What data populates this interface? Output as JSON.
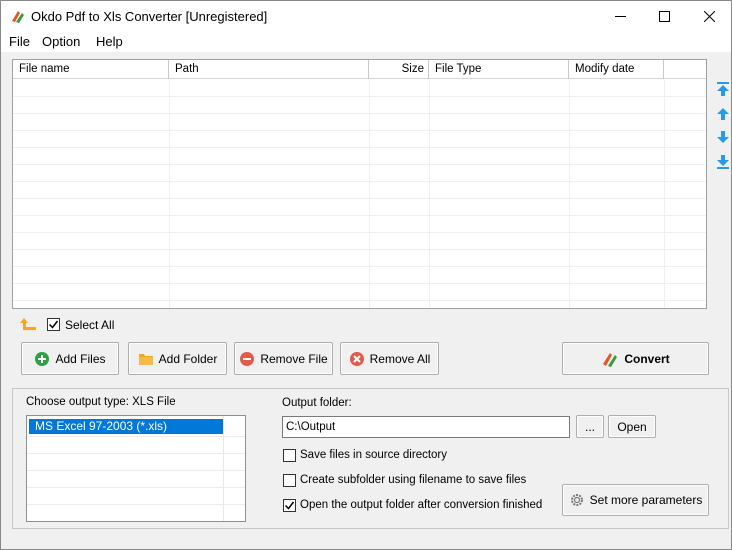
{
  "window": {
    "title": "Okdo Pdf to Xls Converter [Unregistered]"
  },
  "menu": [
    "File",
    "Option",
    "Help"
  ],
  "file_list": {
    "columns": [
      "File name",
      "Path",
      "Size",
      "File Type",
      "Modify date"
    ],
    "rows": []
  },
  "select_all": {
    "label": "Select All",
    "checked": true
  },
  "buttons": {
    "add_files": "Add Files",
    "add_folder": "Add Folder",
    "remove_file": "Remove File",
    "remove_all": "Remove All",
    "convert": "Convert",
    "browse": "...",
    "open": "Open",
    "set_params": "Set more parameters"
  },
  "output": {
    "type_label": "Choose output type:  XLS File",
    "types": [
      "MS Excel 97-2003 (*.xls)"
    ],
    "folder_label": "Output folder:",
    "folder_value": "C:\\Output"
  },
  "options": {
    "save_in_source": {
      "label": "Save files in source directory",
      "checked": false
    },
    "create_subfolder": {
      "label": "Create subfolder using filename to save files",
      "checked": false
    },
    "open_after": {
      "label": "Open the output folder after conversion finished",
      "checked": true
    }
  },
  "colors": {
    "selection": "#0078d7",
    "arrow_blue": "#2a9ae6",
    "folder_orange": "#f5a623",
    "green": "#2ea043",
    "red": "#e25b4a"
  }
}
